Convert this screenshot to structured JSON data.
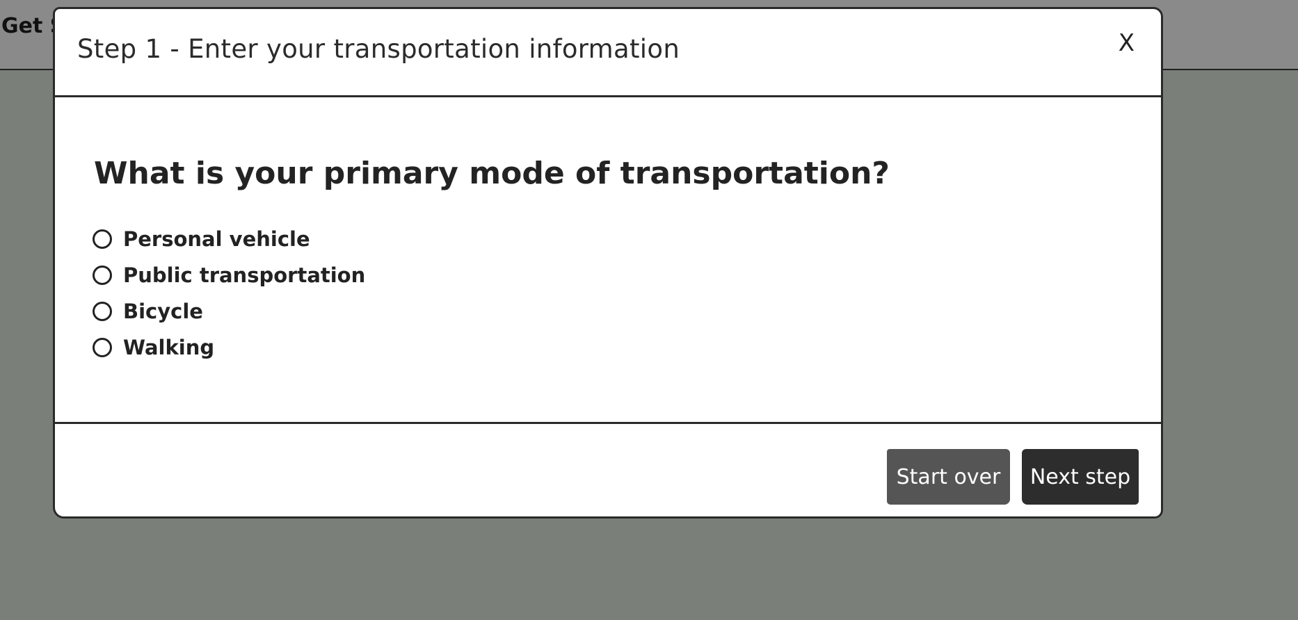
{
  "background_page": {
    "header_text": "Get S"
  },
  "modal": {
    "title": "Step 1 - Enter your transportation information",
    "close_label": "X",
    "question": "What is your primary mode of transportation?",
    "options": [
      {
        "label": "Personal vehicle",
        "selected": false
      },
      {
        "label": "Public transportation",
        "selected": false
      },
      {
        "label": "Bicycle",
        "selected": false
      },
      {
        "label": "Walking",
        "selected": false
      }
    ],
    "buttons": {
      "start_over": "Start over",
      "next_step": "Next step"
    }
  },
  "colors": {
    "overlay": "#7a7f7a",
    "modal_background": "#ffffff",
    "start_over_button": "#555555",
    "next_step_button": "#2d2d2d",
    "text": "#222222"
  }
}
